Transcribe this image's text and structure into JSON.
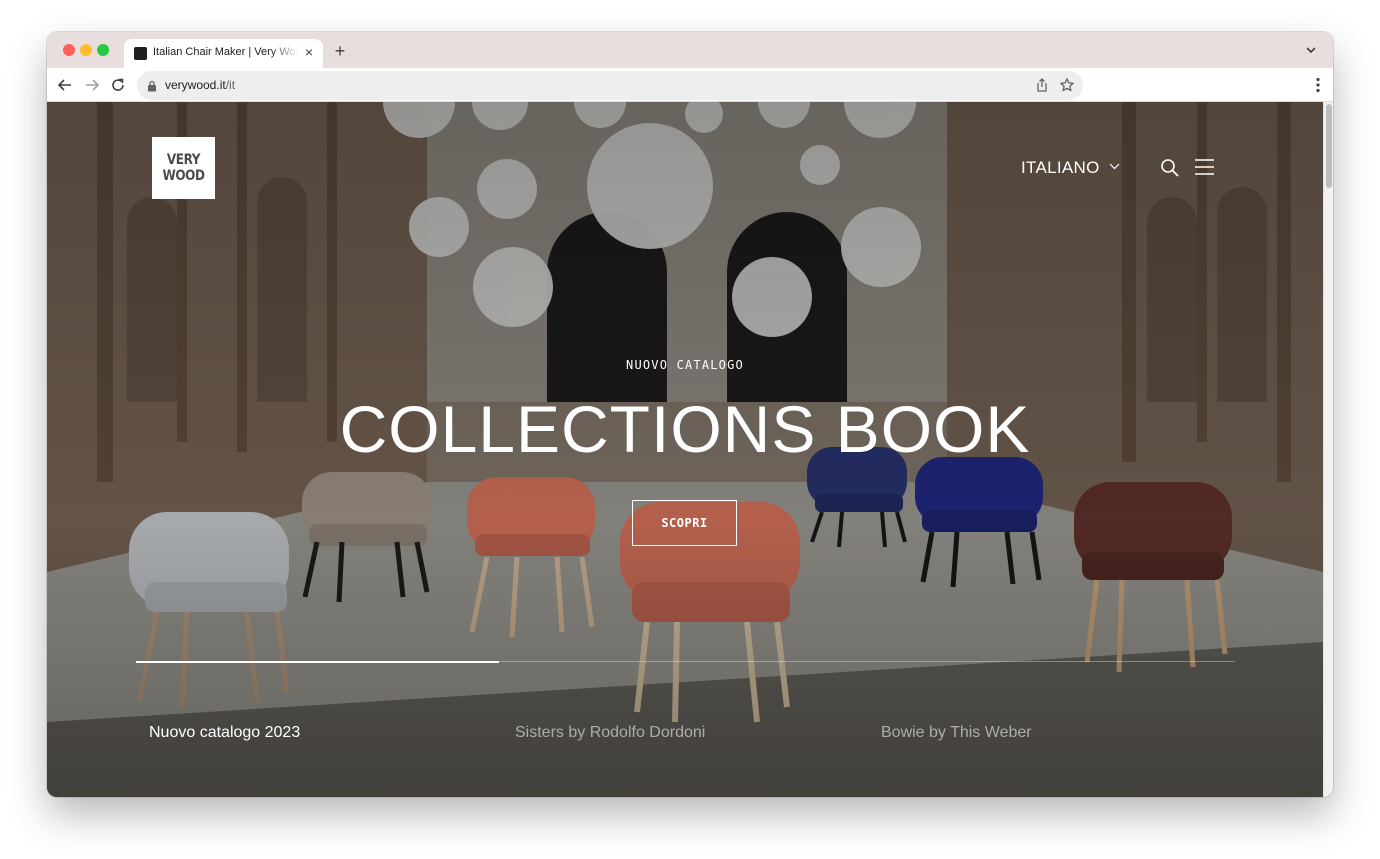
{
  "browser": {
    "tab_title": "Italian Chair Maker | Very Wood",
    "tab_close": "×",
    "new_tab": "+",
    "url_host": "verywood.it",
    "url_path": "/it"
  },
  "site": {
    "logo_line1": "VERY",
    "logo_line2": "WOOD",
    "language": "ITALIANO"
  },
  "hero": {
    "eyebrow": "NUOVO CATALOGO",
    "title": "COLLECTIONS BOOK",
    "cta": "SCOPRI",
    "slides": [
      "Nuovo catalogo 2023",
      "Sisters by Rodolfo Dordoni",
      "Bowie by This Weber"
    ],
    "active_slide": 1,
    "slide_count": 3,
    "progress_fraction": 0.33
  },
  "colors": {
    "titlebar": "#e8dedd",
    "chair_grey": "#b9bcbf",
    "chair_taupe": "#978b80",
    "chair_coral": "#c76a55",
    "chair_navy": "#26306a",
    "chair_blue": "#1f267a",
    "chair_brown": "#5a2e28"
  },
  "icons": {
    "search": "search-icon",
    "menu": "hamburger-menu-icon",
    "chevron": "chevron-down-icon"
  }
}
